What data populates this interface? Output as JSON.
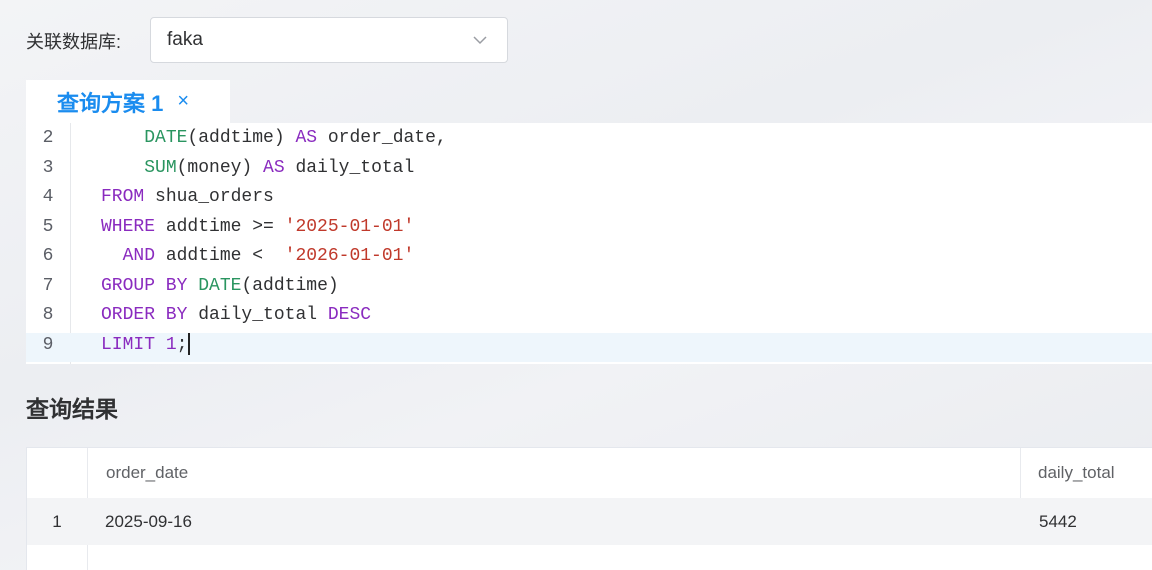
{
  "database": {
    "label": "关联数据库:",
    "selected": "faka"
  },
  "tab": {
    "label": "查询方案 1",
    "close": "×"
  },
  "editor": {
    "lines": [
      {
        "num": "2",
        "tokens": [
          [
            "",
            "    "
          ],
          [
            "fn",
            "DATE"
          ],
          [
            "",
            "(addtime) "
          ],
          [
            "kw",
            "AS"
          ],
          [
            "",
            " order_date,"
          ]
        ]
      },
      {
        "num": "3",
        "tokens": [
          [
            "",
            "    "
          ],
          [
            "fn",
            "SUM"
          ],
          [
            "",
            "(money) "
          ],
          [
            "kw",
            "AS"
          ],
          [
            "",
            " daily_total"
          ]
        ]
      },
      {
        "num": "4",
        "tokens": [
          [
            "kw",
            "FROM"
          ],
          [
            "",
            " shua_orders"
          ]
        ]
      },
      {
        "num": "5",
        "tokens": [
          [
            "kw",
            "WHERE"
          ],
          [
            "",
            " addtime >= "
          ],
          [
            "str",
            "'2025-01-01'"
          ]
        ]
      },
      {
        "num": "6",
        "tokens": [
          [
            "",
            "  "
          ],
          [
            "kw",
            "AND"
          ],
          [
            "",
            " addtime <  "
          ],
          [
            "str",
            "'2026-01-01'"
          ]
        ]
      },
      {
        "num": "7",
        "tokens": [
          [
            "kw",
            "GROUP BY"
          ],
          [
            "",
            " "
          ],
          [
            "fn",
            "DATE"
          ],
          [
            "",
            "(addtime)"
          ]
        ]
      },
      {
        "num": "8",
        "tokens": [
          [
            "kw",
            "ORDER BY"
          ],
          [
            "",
            " daily_total "
          ],
          [
            "kw",
            "DESC"
          ]
        ]
      },
      {
        "num": "9",
        "tokens": [
          [
            "kw",
            "LIMIT"
          ],
          [
            "",
            " "
          ],
          [
            "kw",
            "1"
          ],
          [
            "",
            ";"
          ]
        ],
        "active": true
      }
    ]
  },
  "result": {
    "title": "查询结果",
    "columns": [
      "order_date",
      "daily_total"
    ],
    "rows": [
      {
        "index": "1",
        "cells": [
          "2025-09-16",
          "5442"
        ]
      }
    ]
  }
}
